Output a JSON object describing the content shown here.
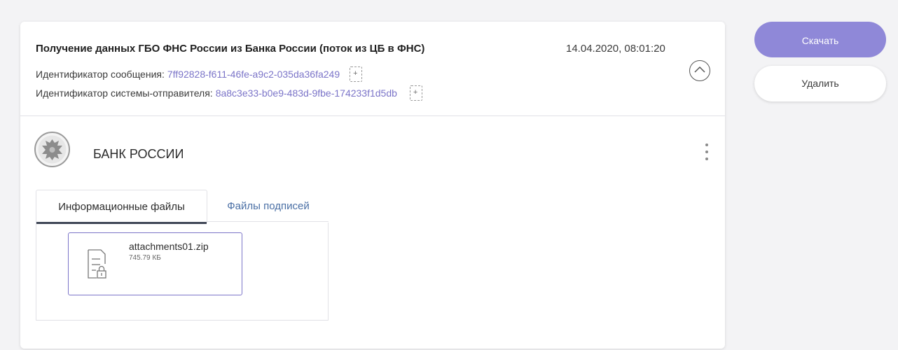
{
  "message": {
    "title": "Получение данных ГБО ФНС России из Банка России (поток из ЦБ в ФНС)",
    "date": "14.04.2020, 08:01:20",
    "message_id_label": "Идентификатор сообщения:",
    "message_id_value": "7ff92828-f611-46fe-a9c2-035da36fa249",
    "sender_id_label": "Идентификатор системы-отправителя:",
    "sender_id_value": "8a8c3e33-b0e9-483d-9fbe-174233f1d5db"
  },
  "organization": {
    "name": "БАНК РОССИИ"
  },
  "tabs": [
    {
      "label": "Информационные файлы",
      "active": true
    },
    {
      "label": "Файлы подписей",
      "active": false
    }
  ],
  "files": [
    {
      "name": "attachments01.zip",
      "size": "745.79 КБ"
    }
  ],
  "actions": {
    "download_label": "Скачать",
    "delete_label": "Удалить"
  },
  "colors": {
    "accent": "#8f88d8",
    "link": "#7b74c8",
    "tab_link": "#4a6fa5"
  },
  "icons": {
    "copy": "copy-icon",
    "collapse": "chevron-up-circle-icon",
    "menu": "kebab-menu-icon",
    "file": "locked-document-icon",
    "emblem": "bank-of-russia-emblem"
  }
}
